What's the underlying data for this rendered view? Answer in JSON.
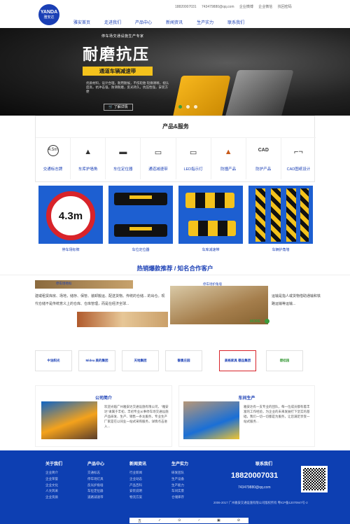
{
  "header": {
    "logo_text": "YANDA",
    "logo_sub": "雅安达",
    "top_links": [
      "18820007031",
      "743479880@qq.com",
      "企业微博",
      "企业微信",
      "找回密码"
    ],
    "nav": [
      "雅安首页",
      "走进我们",
      "产品中心",
      "新闻资讯",
      "生产实力",
      "联系我们"
    ]
  },
  "banner": {
    "subtitle": "停车场交通设施生产专家",
    "title": "耐磨抗压",
    "bar": "通道车辆减速带",
    "description": "优质材料，设计合理，耐用耐候，不伤轮胎 轮廓清晰，视认度高，抗冲击强，防滑耐磨，反光持久，抗压性强，安装方便",
    "button": "了解详情"
  },
  "products_services": {
    "title": "产品&服务",
    "items": [
      {
        "icon": "4.5m",
        "label": "交通标志牌"
      },
      {
        "icon": "▲",
        "label": "车库护墙角"
      },
      {
        "icon": "▬",
        "label": "车位定位器"
      },
      {
        "icon": "▭",
        "label": "通道减速带"
      },
      {
        "icon": "▭",
        "label": "LED指示灯"
      },
      {
        "icon": "▲",
        "label": "防撞产品"
      },
      {
        "icon": "CAD",
        "label": "防护产品"
      },
      {
        "icon": "⌐¬",
        "label": "CAD图纸设计"
      }
    ]
  },
  "tiles": [
    {
      "label": "停车场标牌",
      "sign_text": "4.3m"
    },
    {
      "label": "车位定位器"
    },
    {
      "label": "车库减速带"
    },
    {
      "label": "车辆护角墙"
    }
  ],
  "hot": {
    "title": "热销爆款推荐 / 知名合作客户",
    "label1": "停车场地标",
    "text1": "建或租赁库房、场地，储存、保管、装卸搬运、配送货物。传统的仓储... 的出仓。现代仓储不是传统意义上的仓库、仓库管理，而是在经济全球...",
    "label2": "停车场护角墙",
    "text2": "运输是指人或货物借助通输和铁路运输等运输...",
    "more": "MORE"
  },
  "clients": [
    "中油阳光",
    "Midea 美的集团",
    "天地集团",
    "御景庄园",
    "美格家具 德品集团",
    "碧桂园"
  ],
  "about": {
    "title": "公司简介",
    "text": "欢迎光临广州雅安达交通设施有限公司，\"雅安达\"隶属于丰初，丰初专业从事停车场交通设施产品研发、生产、销售一条龙服务，专业生产厂家是在以同业一站式采购服务，详情点击进入..."
  },
  "production": {
    "title": "车间生产",
    "text": "雅安达有一支专业的团队，每一位成员都有着丰富的工作经验，为企业的未来发展打下坚实的基础，我们一切一切都是为服务，让您满足享受一站式服务..."
  },
  "footer": {
    "columns": [
      {
        "head": "关于我们",
        "items": [
          "企业简介",
          "企业荣誉",
          "企业文化",
          "人文风采",
          "企业资质"
        ]
      },
      {
        "head": "产品中心",
        "items": [
          "交通标志",
          "停车场灯具",
          "反光护角墙",
          "车位定位器",
          "道路减速带"
        ]
      },
      {
        "head": "新闻资讯",
        "items": [
          "行业新闻",
          "企业动态",
          "产品百科",
          "安装说明",
          "物流方案"
        ]
      },
      {
        "head": "生产实力",
        "items": [
          "研发团队",
          "生产设备",
          "生产能力",
          "车间实景",
          "仓储库存"
        ]
      }
    ],
    "contact_head": "联系我们",
    "phone": "18820007031",
    "email": "743479880@qq.com",
    "copyright": "2006-2017 广州雅安交通设施有限公司版权所有 粤ICP备12070947号-2",
    "bar_icons": [
      "五",
      "✓",
      "⊙",
      "♂",
      "▣",
      "⊘"
    ]
  },
  "colors": {
    "brand": "#1a3fb5",
    "accent_yellow": "#f4c21c",
    "green": "#3b9b3b",
    "footer": "#0d3fb2"
  }
}
